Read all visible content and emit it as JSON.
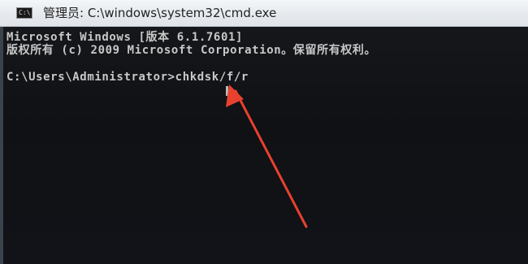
{
  "window": {
    "title": "管理员: C:\\windows\\system32\\cmd.exe",
    "icon": "console-icon",
    "icon_glyph": "C:\\"
  },
  "console": {
    "lines": [
      "Microsoft Windows [版本 6.1.7601]",
      "版权所有 (c) 2009 Microsoft Corporation。保留所有权利。",
      "",
      "C:\\Users\\Administrator>chkdsk/f/r"
    ]
  },
  "annotation": {
    "arrow_color": "#e8412f"
  }
}
